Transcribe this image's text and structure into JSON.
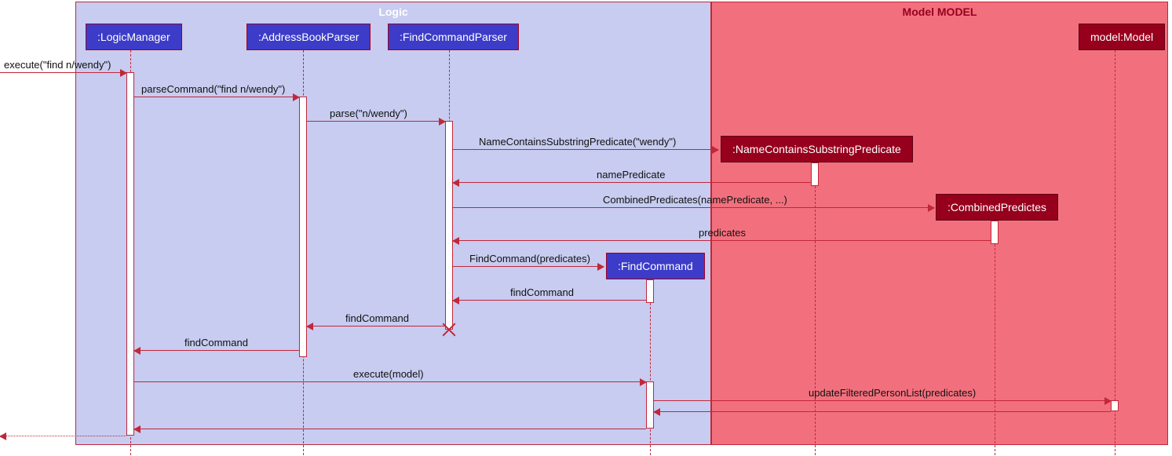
{
  "containers": {
    "logic": {
      "title": "Logic"
    },
    "model": {
      "title": "Model MODEL"
    }
  },
  "participants": {
    "logicManager": ":LogicManager",
    "addressBookParser": ":AddressBookParser",
    "findCommandParser": ":FindCommandParser",
    "nameContainsSubstringPredicate": ":NameContainsSubstringPredicate",
    "combinedPredicates": ":CombinedPredictes",
    "findCommand": ":FindCommand",
    "model": "model:Model"
  },
  "messages": {
    "m01": "execute(\"find n/wendy\")",
    "m02": "parseCommand(\"find n/wendy\")",
    "m03": "parse(\"n/wendy\")",
    "m04": "NameContainsSubstringPredicate(\"wendy\")",
    "m05": "namePredicate",
    "m06": "CombinedPredicates(namePredicate, ...)",
    "m07": "predicates",
    "m08": "FindCommand(predicates)",
    "m09": "findCommand",
    "m10": "findCommand",
    "m11": "findCommand",
    "m12": "execute(model)",
    "m13": "updateFilteredPersonList(predicates)"
  },
  "chart_data": {
    "type": "sequence-diagram",
    "containers": [
      {
        "name": "Logic",
        "participants": [
          ":LogicManager",
          ":AddressBookParser",
          ":FindCommandParser",
          ":FindCommand"
        ]
      },
      {
        "name": "Model MODEL",
        "participants": [
          ":NameContainsSubstringPredicate",
          ":CombinedPredictes",
          "model:Model"
        ]
      }
    ],
    "participants": [
      ":LogicManager",
      ":AddressBookParser",
      ":FindCommandParser",
      ":NameContainsSubstringPredicate",
      ":CombinedPredictes",
      ":FindCommand",
      "model:Model"
    ],
    "messages": [
      {
        "from": "external",
        "to": ":LogicManager",
        "label": "execute(\"find n/wendy\")",
        "type": "call"
      },
      {
        "from": ":LogicManager",
        "to": ":AddressBookParser",
        "label": "parseCommand(\"find n/wendy\")",
        "type": "call"
      },
      {
        "from": ":AddressBookParser",
        "to": ":FindCommandParser",
        "label": "parse(\"n/wendy\")",
        "type": "call"
      },
      {
        "from": ":FindCommandParser",
        "to": ":NameContainsSubstringPredicate",
        "label": "NameContainsSubstringPredicate(\"wendy\")",
        "type": "create"
      },
      {
        "from": ":NameContainsSubstringPredicate",
        "to": ":FindCommandParser",
        "label": "namePredicate",
        "type": "return"
      },
      {
        "from": ":FindCommandParser",
        "to": ":CombinedPredictes",
        "label": "CombinedPredicates(namePredicate, ...)",
        "type": "create"
      },
      {
        "from": ":CombinedPredictes",
        "to": ":FindCommandParser",
        "label": "predicates",
        "type": "return"
      },
      {
        "from": ":FindCommandParser",
        "to": ":FindCommand",
        "label": "FindCommand(predicates)",
        "type": "create"
      },
      {
        "from": ":FindCommand",
        "to": ":FindCommandParser",
        "label": "findCommand",
        "type": "return"
      },
      {
        "from": ":FindCommandParser",
        "to": ":AddressBookParser",
        "label": "findCommand",
        "type": "return",
        "destroy": ":FindCommandParser"
      },
      {
        "from": ":AddressBookParser",
        "to": ":LogicManager",
        "label": "findCommand",
        "type": "return"
      },
      {
        "from": ":LogicManager",
        "to": ":FindCommand",
        "label": "execute(model)",
        "type": "call"
      },
      {
        "from": ":FindCommand",
        "to": "model:Model",
        "label": "updateFilteredPersonList(predicates)",
        "type": "call"
      },
      {
        "from": "model:Model",
        "to": ":FindCommand",
        "label": "",
        "type": "return"
      },
      {
        "from": ":FindCommand",
        "to": ":LogicManager",
        "label": "",
        "type": "return"
      },
      {
        "from": ":LogicManager",
        "to": "external",
        "label": "",
        "type": "return"
      }
    ]
  }
}
